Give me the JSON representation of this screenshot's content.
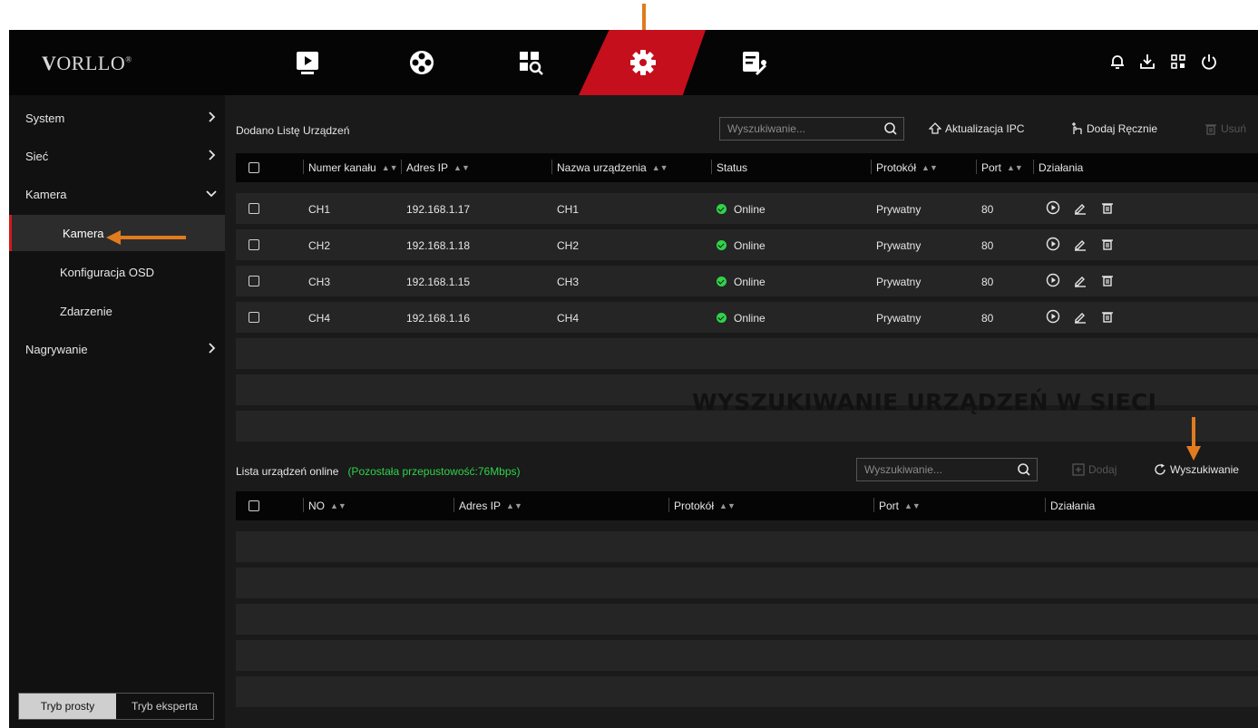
{
  "brand": {
    "logo_text": "ORLLO",
    "logo_reg": "®"
  },
  "nav": {
    "tabs": [
      {
        "name": "playback-icon"
      },
      {
        "name": "film-reel-icon"
      },
      {
        "name": "search-grid-icon"
      },
      {
        "name": "settings-gear-icon",
        "active": true
      },
      {
        "name": "maintenance-icon"
      }
    ],
    "right_icons": [
      "bell-icon",
      "download-icon",
      "qr-grid-icon",
      "power-icon"
    ]
  },
  "sidebar": {
    "items": [
      {
        "label": "System",
        "chevron": "right"
      },
      {
        "label": "Sieć",
        "chevron": "right"
      },
      {
        "label": "Kamera",
        "chevron": "down"
      },
      {
        "label": "Kamera",
        "active": true
      },
      {
        "label": "Konfiguracja OSD"
      },
      {
        "label": "Zdarzenie"
      },
      {
        "label": "Nagrywanie",
        "chevron": "right"
      }
    ],
    "modes": {
      "simple": "Tryb prosty",
      "expert": "Tryb eksperta"
    }
  },
  "added": {
    "title": "Dodano Listę Urządzeń",
    "search_placeholder": "Wyszukiwanie...",
    "update_ipc": "Aktualizacja IPC",
    "add_manual": "Dodaj Ręcznie",
    "delete": "Usuń",
    "columns": {
      "channel": "Numer kanału",
      "ip": "Adres IP",
      "name": "Nazwa urządzenia",
      "status": "Status",
      "protocol": "Protokół",
      "port": "Port",
      "actions": "Działania"
    },
    "rows": [
      {
        "channel": "CH1",
        "ip": "192.168.1.17",
        "name": "CH1",
        "status": "Online",
        "protocol": "Prywatny",
        "port": "80"
      },
      {
        "channel": "CH2",
        "ip": "192.168.1.18",
        "name": "CH2",
        "status": "Online",
        "protocol": "Prywatny",
        "port": "80"
      },
      {
        "channel": "CH3",
        "ip": "192.168.1.15",
        "name": "CH3",
        "status": "Online",
        "protocol": "Prywatny",
        "port": "80"
      },
      {
        "channel": "CH4",
        "ip": "192.168.1.16",
        "name": "CH4",
        "status": "Online",
        "protocol": "Prywatny",
        "port": "80"
      }
    ]
  },
  "online": {
    "title": "Lista urządzeń online",
    "bandwidth": "(Pozostała przepustowość:76Mbps)",
    "search_placeholder": "Wyszukiwanie...",
    "add": "Dodaj",
    "search_button": "Wyszukiwanie",
    "columns": {
      "no": "NO",
      "ip": "Adres IP",
      "protocol": "Protokół",
      "port": "Port",
      "actions": "Działania"
    }
  },
  "annotation": {
    "text": "WYSZUKIWANIE URZĄDZEŃ W SIECI"
  },
  "colors": {
    "accent_red": "#c50f1c",
    "online_green": "#2fd34a",
    "arrow_orange": "#e07b1f"
  }
}
